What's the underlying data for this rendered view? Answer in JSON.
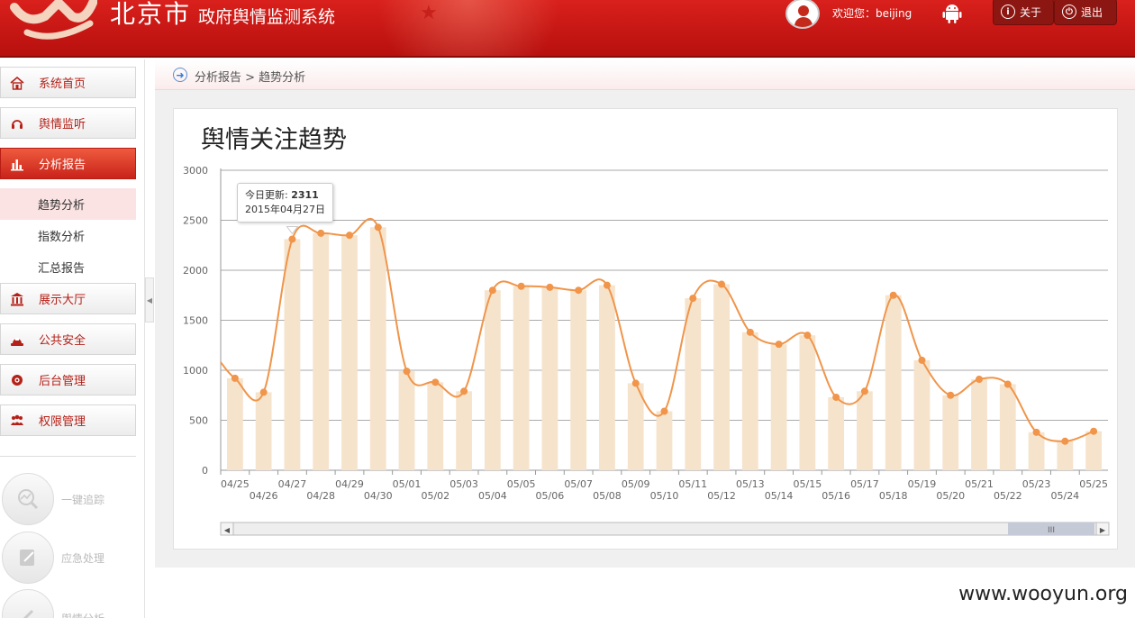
{
  "header": {
    "city": "北京市",
    "system_name": "政府舆情监测系统",
    "welcome": "欢迎您：beijing",
    "about_label": "关于",
    "logout_label": "退出",
    "avatar_icon": "user-avatar-icon",
    "android_icon": "android-icon"
  },
  "sidebar": {
    "items": [
      {
        "label": "系统首页",
        "icon": "home-icon"
      },
      {
        "label": "舆情监听",
        "icon": "headphones-icon"
      },
      {
        "label": "分析报告",
        "icon": "bar-chart-icon",
        "active": true
      },
      {
        "label": "展示大厅",
        "icon": "museum-icon"
      },
      {
        "label": "公共安全",
        "icon": "police-light-icon"
      },
      {
        "label": "后台管理",
        "icon": "settings-icon"
      },
      {
        "label": "权限管理",
        "icon": "users-icon"
      }
    ],
    "subitems": [
      {
        "label": "趋势分析",
        "active": true
      },
      {
        "label": "指数分析"
      },
      {
        "label": "汇总报告"
      }
    ],
    "quick": [
      {
        "label": "一键追踪",
        "icon": "trend-track-icon"
      },
      {
        "label": "应急处理",
        "icon": "edit-document-icon"
      },
      {
        "label": "舆情分析",
        "icon": "pen-icon"
      }
    ]
  },
  "breadcrumb": {
    "text": "分析报告 > 趋势分析",
    "icon": "arrow-circle-icon"
  },
  "panel": {
    "title": "舆情关注趋势"
  },
  "tooltip": {
    "label": "今日更新:",
    "value": "2311",
    "date": "2015年04月27日"
  },
  "watermark": "www.wooyun.org",
  "chart_data": {
    "type": "bar",
    "title": "舆情关注趋势",
    "xlabel": "",
    "ylabel": "",
    "ylim": [
      0,
      3000
    ],
    "yticks": [
      0,
      500,
      1000,
      1500,
      2000,
      2500,
      3000
    ],
    "grid": true,
    "categories": [
      "04/25",
      "04/26",
      "04/27",
      "04/28",
      "04/29",
      "04/30",
      "05/01",
      "05/02",
      "05/03",
      "05/04",
      "05/05",
      "05/06",
      "05/07",
      "05/08",
      "05/09",
      "05/10",
      "05/11",
      "05/12",
      "05/13",
      "05/14",
      "05/15",
      "05/16",
      "05/17",
      "05/18",
      "05/19",
      "05/20",
      "05/21",
      "05/22",
      "05/23",
      "05/24",
      "05/25"
    ],
    "series": [
      {
        "type": "bar",
        "color": "#f6e3cc",
        "values": [
          920,
          780,
          2311,
          2370,
          2350,
          2430,
          990,
          880,
          790,
          1800,
          1840,
          1830,
          1800,
          1850,
          870,
          590,
          1720,
          1860,
          1380,
          1260,
          1350,
          730,
          790,
          1750,
          1100,
          750,
          910,
          860,
          380,
          290,
          390
        ]
      },
      {
        "type": "line",
        "color": "#f0954a",
        "smooth": true,
        "values": [
          920,
          780,
          2311,
          2370,
          2350,
          2430,
          990,
          880,
          790,
          1800,
          1840,
          1830,
          1800,
          1850,
          870,
          590,
          1720,
          1860,
          1380,
          1260,
          1350,
          730,
          790,
          1750,
          1100,
          750,
          910,
          860,
          380,
          290,
          390
        ]
      }
    ]
  }
}
